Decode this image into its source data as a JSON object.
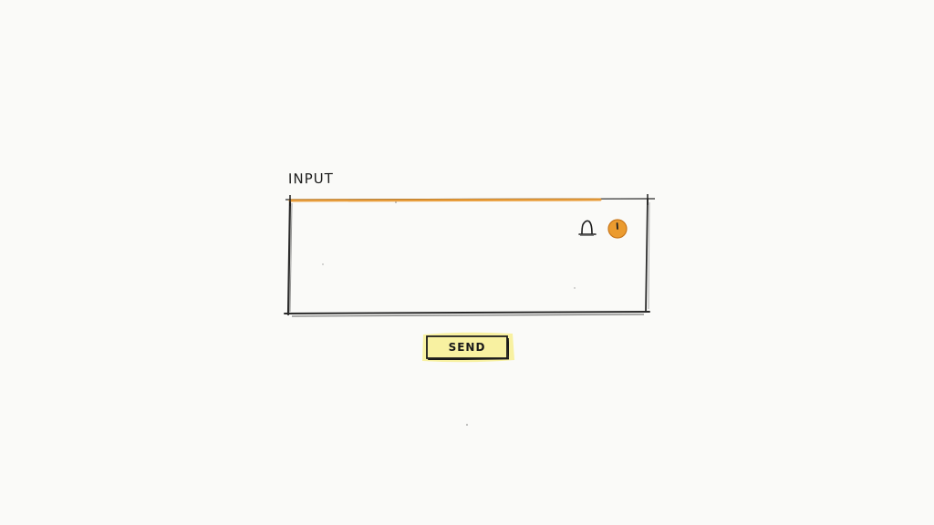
{
  "form": {
    "label": "INPUT",
    "input_value": "",
    "send_label": "SEND"
  },
  "icons": {
    "bell": "bell-icon",
    "status": "alert-circle-icon"
  },
  "colors": {
    "accent": "#e8962b",
    "highlight": "#f5ea5a",
    "ink": "#222222",
    "paper": "#fafaf8"
  }
}
